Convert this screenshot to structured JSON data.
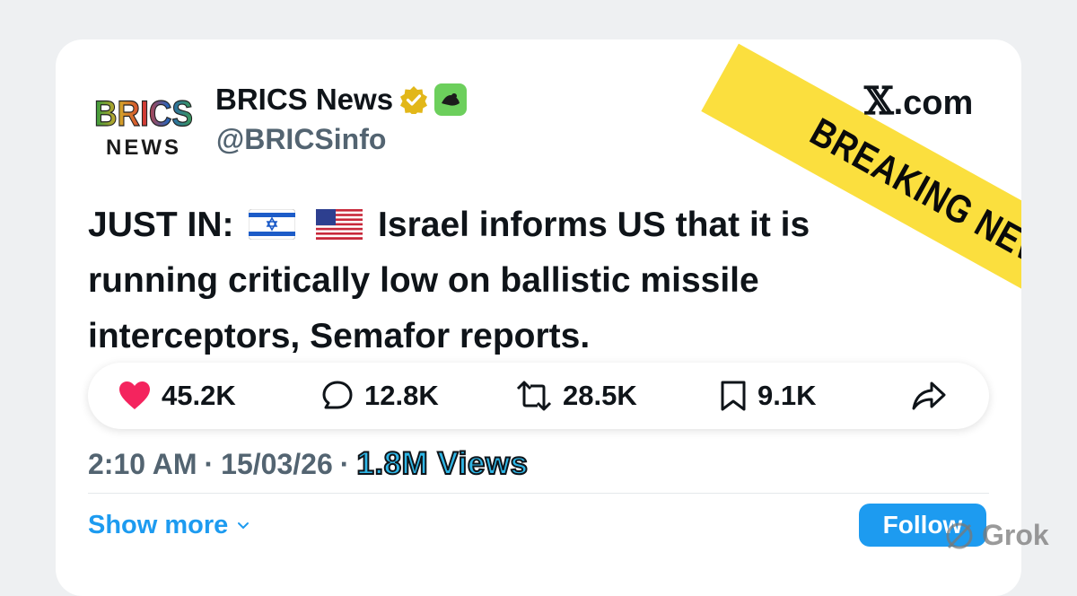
{
  "banner": {
    "text": "BREAKING NEWS",
    "color": "#fbdf3e"
  },
  "source_site": {
    "symbol": "𝕏",
    "domain": ".com"
  },
  "account": {
    "logo_top": "BRICS",
    "logo_bottom": "NEWS",
    "name": "BRICS News",
    "handle": "@BRICSinfo",
    "verified_badge": "gold-check-icon",
    "affiliate_badge": "green-badge-icon"
  },
  "tweet": {
    "prefix": "JUST IN:",
    "flags": [
      "israel-flag-icon",
      "us-flag-icon"
    ],
    "text": "Israel informs US that it is running critically  low on ballistic missile interceptors, Semafor reports."
  },
  "actions": {
    "likes": "45.2K",
    "replies": "12.8K",
    "reposts": "28.5K",
    "bookmarks": "9.1K",
    "like_color": "#f4245e"
  },
  "meta": {
    "time": "2:10 AM",
    "sep1": "·",
    "date": "15/03/26",
    "sep2": "·",
    "views": "1.8M Views"
  },
  "footer": {
    "show_more": "Show more",
    "follow_label": "Follow",
    "watermark": "Grok",
    "accent": "#1d9bf0"
  }
}
